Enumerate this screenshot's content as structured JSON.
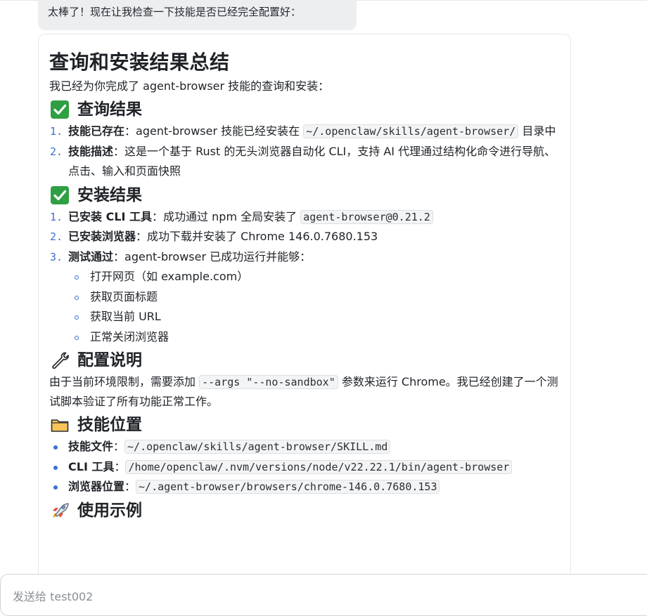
{
  "previous_message": "太棒了！现在让我检查一下技能是否已经完全配置好：",
  "message": {
    "title": "查询和安装结果总结",
    "intro": "我已经为你完成了 agent-browser 技能的查询和安装：",
    "query_section": {
      "icon": "check-mark-button-icon",
      "heading": "查询结果",
      "items": [
        {
          "num": "1.",
          "label": "技能已存在",
          "sep": "：",
          "text": "agent-browser 技能已经安装在 ",
          "code": "~/.openclaw/skills/agent-browser/",
          "suffix": " 目录中"
        },
        {
          "num": "2.",
          "label": "技能描述",
          "sep": "：",
          "text": "这是一个基于 Rust 的无头浏览器自动化 CLI，支持 AI 代理通过结构化命令进行导航、点击、输入和页面快照"
        }
      ]
    },
    "install_section": {
      "icon": "check-mark-button-icon",
      "heading": "安装结果",
      "items": [
        {
          "num": "1.",
          "label": "已安装 CLI 工具",
          "sep": "：",
          "text": "成功通过 npm 全局安装了 ",
          "code": "agent-browser@0.21.2"
        },
        {
          "num": "2.",
          "label": "已安装浏览器",
          "sep": "：",
          "text": "成功下载并安装了 Chrome 146.0.7680.153"
        },
        {
          "num": "3.",
          "label": "测试通过",
          "sep": "：",
          "text": "agent-browser 已成功运行并能够："
        }
      ],
      "capabilities": [
        "打开网页（如 example.com）",
        "获取页面标题",
        "获取当前 URL",
        "正常关闭浏览器"
      ]
    },
    "config_section": {
      "icon": "wrench-icon",
      "heading": "配置说明",
      "text_before": "由于当前环境限制，需要添加 ",
      "code": "--args \"--no-sandbox\"",
      "text_after": " 参数来运行 Chrome。我已经创建了一个测试脚本验证了所有功能正常工作。"
    },
    "location_section": {
      "icon": "folder-icon",
      "heading": "技能位置",
      "items": [
        {
          "label": "技能文件",
          "sep": "：",
          "code": "~/.openclaw/skills/agent-browser/SKILL.md"
        },
        {
          "label": "CLI 工具",
          "sep": "：",
          "code": "/home/openclaw/.nvm/versions/node/v22.22.1/bin/agent-browser"
        },
        {
          "label": "浏览器位置",
          "sep": "：",
          "code": "~/.agent-browser/browsers/chrome-146.0.7680.153"
        }
      ]
    },
    "usage_section": {
      "icon": "rocket-icon",
      "heading": "使用示例"
    }
  },
  "composer": {
    "placeholder": "发送给 test002"
  },
  "colors": {
    "accent": "#3b6fd2",
    "check_green": "#2ea043",
    "folder_orange": "#f0a32e",
    "bubble_bg": "#eceef0"
  }
}
